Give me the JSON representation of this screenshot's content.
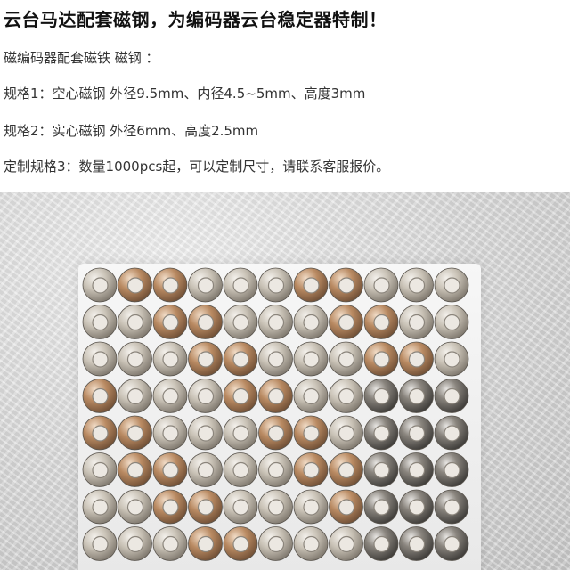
{
  "title": "云台马达配套磁钢，为编码器云台稳定器特制！",
  "lines": [
    "磁编码器配套磁铁 磁钢 ：",
    "规格1：空心磁钢 外径9.5mm、内径4.5~5mm、高度3mm",
    "规格2：实心磁钢 外径6mm、高度2.5mm",
    "定制规格3：数量1000pcs起，可以定制尺寸，请联系客服报价。"
  ],
  "photo": {
    "subject": "ring-magnets-on-tray",
    "colors": {
      "metal_light": "#d8d2c8",
      "metal_dark": "#6f6a62",
      "copper": "#b98a62",
      "bore": "#ece8e2"
    }
  }
}
